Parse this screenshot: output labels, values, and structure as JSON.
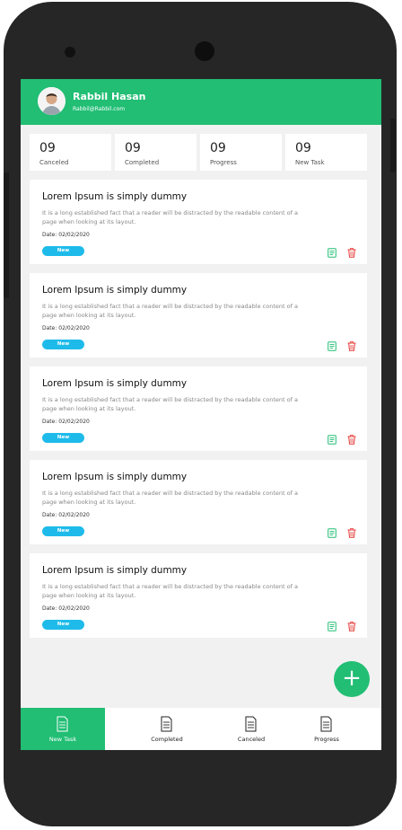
{
  "user": {
    "name": "Rabbil Hasan",
    "email": "Rabbil@Rabbil.com"
  },
  "stats": [
    {
      "value": "09",
      "label": "Canceled"
    },
    {
      "value": "09",
      "label": "Completed"
    },
    {
      "value": "09",
      "label": "Progress"
    },
    {
      "value": "09",
      "label": "New Task"
    }
  ],
  "tasks": [
    {
      "title": "Lorem Ipsum is simply dummy",
      "description": "It is a long established fact that a reader will be distracted by the readable content of a page when looking at its layout.",
      "date": "Date: 02/02/2020",
      "status": "New"
    },
    {
      "title": "Lorem Ipsum is simply dummy",
      "description": "It is a long established fact that a reader will be distracted by the readable content of a page when looking at its layout.",
      "date": "Date: 02/02/2020",
      "status": "New"
    },
    {
      "title": "Lorem Ipsum is simply dummy",
      "description": "It is a long established fact that a reader will be distracted by the readable content of a page when looking at its layout.",
      "date": "Date: 02/02/2020",
      "status": "New"
    },
    {
      "title": "Lorem Ipsum is simply dummy",
      "description": "It is a long established fact that a reader will be distracted by the readable content of a page when looking at its layout.",
      "date": "Date: 02/02/2020",
      "status": "New"
    },
    {
      "title": "Lorem Ipsum is simply dummy",
      "description": "It is a long established fact that a reader will be distracted by the readable content of a page when looking at its layout.",
      "date": "Date: 02/02/2020",
      "status": "New"
    }
  ],
  "fab": {
    "label": "+"
  },
  "nav": [
    {
      "label": "New Task",
      "icon": "document-icon",
      "active": true
    },
    {
      "label": "Completed",
      "icon": "document-icon",
      "active": false
    },
    {
      "label": "Canceled",
      "icon": "document-icon",
      "active": false
    },
    {
      "label": "Progress",
      "icon": "document-icon",
      "active": false
    }
  ],
  "colors": {
    "primary": "#21be74",
    "badge": "#1ebbea",
    "delete": "#e53935",
    "edit": "#21be74"
  }
}
